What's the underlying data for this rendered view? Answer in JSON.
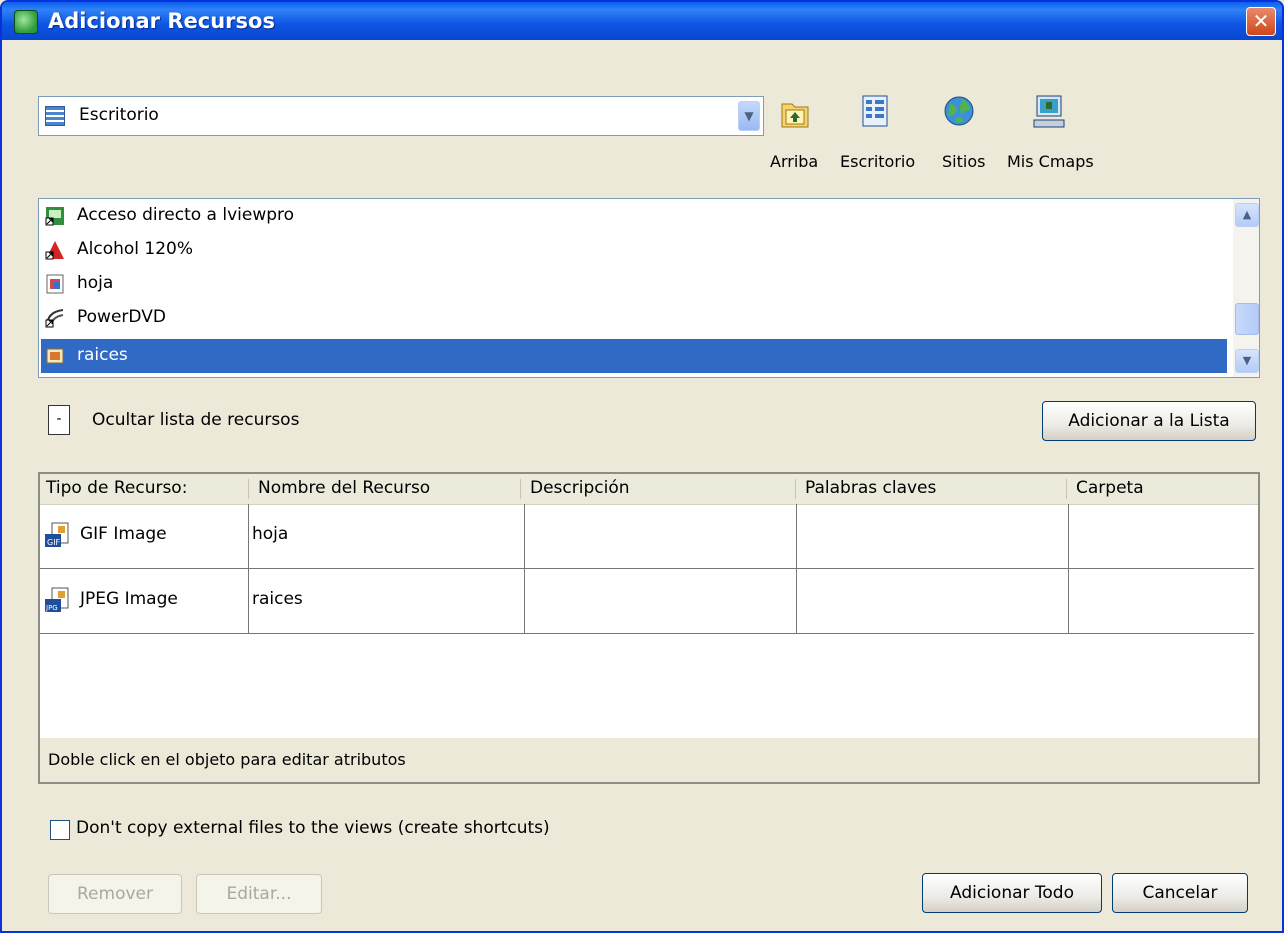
{
  "window": {
    "title": "Adicionar Recursos",
    "close_glyph": "✕"
  },
  "location": {
    "selected": "Escritorio"
  },
  "toolbar": {
    "up_label": "Arriba",
    "desktop_label": "Escritorio",
    "sites_label": "Sitios",
    "mycmaps_label": "Mis Cmaps"
  },
  "file_list": {
    "items": [
      {
        "label": "Acceso directo a lviewpro",
        "icon": "shortcut-app-icon"
      },
      {
        "label": "Alcohol 120%",
        "icon": "alcohol-icon"
      },
      {
        "label": "hoja",
        "icon": "image-file-icon"
      },
      {
        "label": "PowerDVD",
        "icon": "powerdvd-icon"
      },
      {
        "label": "raices",
        "icon": "jpeg-file-icon",
        "selected": true
      }
    ]
  },
  "toggle": {
    "glyph": "-",
    "label": "Ocultar lista de recursos"
  },
  "add_to_list_label": "Adicionar a la Lista",
  "resources_table": {
    "columns": [
      "Tipo de Recurso:",
      "Nombre del Recurso",
      "Descripción",
      "Palabras claves",
      "Carpeta"
    ],
    "rows": [
      {
        "type": "GIF Image",
        "type_icon": "gif-icon",
        "name": "hoja",
        "description": "",
        "keywords": "",
        "folder": ""
      },
      {
        "type": "JPEG Image",
        "type_icon": "jpeg-icon",
        "name": "raices",
        "description": "",
        "keywords": "",
        "folder": ""
      }
    ],
    "status": "Doble click en el objeto para editar atributos"
  },
  "shortcut_checkbox": {
    "label": "Don't copy external files to the views (create shortcuts)",
    "checked": false
  },
  "buttons": {
    "remove": "Remover",
    "edit": "Editar...",
    "add_all": "Adicionar Todo",
    "cancel": "Cancelar"
  },
  "colors": {
    "title_blue": "#0a5ef0",
    "selection": "#316ac5",
    "dialog_bg": "#ece9d8"
  }
}
